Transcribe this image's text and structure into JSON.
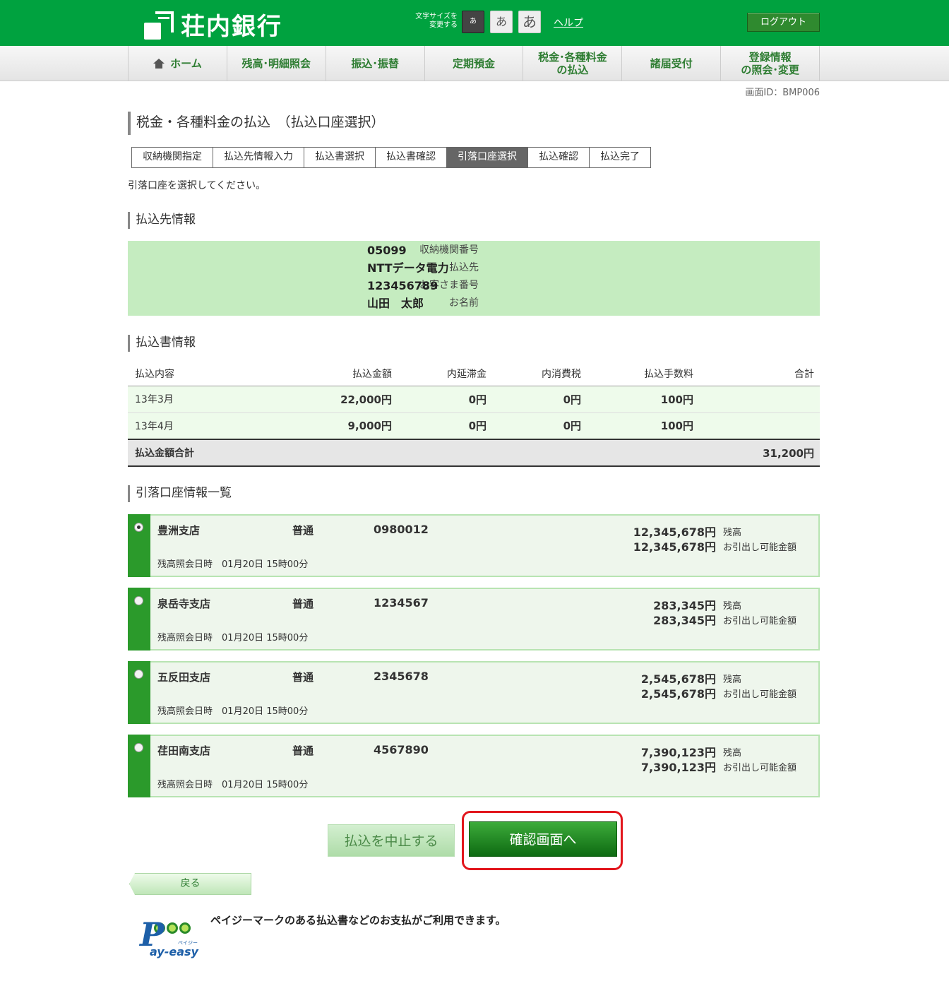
{
  "header": {
    "logo_text": "荘内銀行",
    "fontsize_label_line1": "文字サイズを",
    "fontsize_label_line2": "変更する",
    "fontsize_small": "あ",
    "fontsize_medium": "あ",
    "fontsize_large": "あ",
    "help": "ヘルプ",
    "logout": "ログアウト",
    "brand_color": "#00a23f"
  },
  "nav": {
    "home": "ホーム",
    "balance": "残高･明細照会",
    "transfer": "振込･振替",
    "time_deposit": "定期預金",
    "tax_line1": "税金･各種料金",
    "tax_line2": "の払込",
    "notifications": "諸届受付",
    "registration_line1": "登録情報",
    "registration_line2": "の照会･変更"
  },
  "screen_id": "画面ID：BMP006",
  "page_title": "税金・各種料金の払込　（払込口座選択）",
  "steps": [
    "収納機関指定",
    "払込先情報入力",
    "払込書選択",
    "払込書確認",
    "引落口座選択",
    "払込確認",
    "払込完了"
  ],
  "active_step_index": 4,
  "instruction": "引落口座を選択してください。",
  "payee": {
    "section_title": "払込先情報",
    "rows": [
      {
        "label": "収納機関番号",
        "value": "05099"
      },
      {
        "label": "払込先",
        "value": "NTTデータ電力"
      },
      {
        "label": "お客さま番号",
        "value": "123456789"
      },
      {
        "label": "お名前",
        "value": "山田　太郎"
      }
    ]
  },
  "slips": {
    "section_title": "払込書情報",
    "headers": [
      "払込内容",
      "払込金額",
      "内延滞金",
      "内消費税",
      "払込手数料",
      "合計"
    ],
    "rows": [
      {
        "content": "13年3月",
        "amount": "22,000円",
        "late_fee": "0円",
        "tax": "0円",
        "fee": "100円",
        "total": ""
      },
      {
        "content": "13年4月",
        "amount": "9,000円",
        "late_fee": "0円",
        "tax": "0円",
        "fee": "100円",
        "total": ""
      }
    ],
    "total_label": "払込金額合計",
    "total_value": "31,200円"
  },
  "accounts": {
    "section_title": "引落口座情報一覧",
    "balance_label": "残高",
    "available_label": "お引出し可能金額",
    "inquiry_label": "残高照会日時",
    "items": [
      {
        "branch": "豊洲支店",
        "type": "普通",
        "number": "0980012",
        "balance": "12,345,678円",
        "available": "12,345,678円",
        "inquiry_time": "01月20日 15時00分",
        "selected": true
      },
      {
        "branch": "泉岳寺支店",
        "type": "普通",
        "number": "1234567",
        "balance": "283,345円",
        "available": "283,345円",
        "inquiry_time": "01月20日 15時00分",
        "selected": false
      },
      {
        "branch": "五反田支店",
        "type": "普通",
        "number": "2345678",
        "balance": "2,545,678円",
        "available": "2,545,678円",
        "inquiry_time": "01月20日 15時00分",
        "selected": false
      },
      {
        "branch": "荏田南支店",
        "type": "普通",
        "number": "4567890",
        "balance": "7,390,123円",
        "available": "7,390,123円",
        "inquiry_time": "01月20日 15時00分",
        "selected": false
      }
    ]
  },
  "buttons": {
    "cancel": "払込を中止する",
    "confirm": "確認画面へ",
    "back": "戻る"
  },
  "payeasy": {
    "logo_p": "P",
    "logo_text": "ay-easy",
    "logo_small": "ペイジー",
    "message": "ペイジーマークのある払込書などのお支払がご利用できます。"
  }
}
